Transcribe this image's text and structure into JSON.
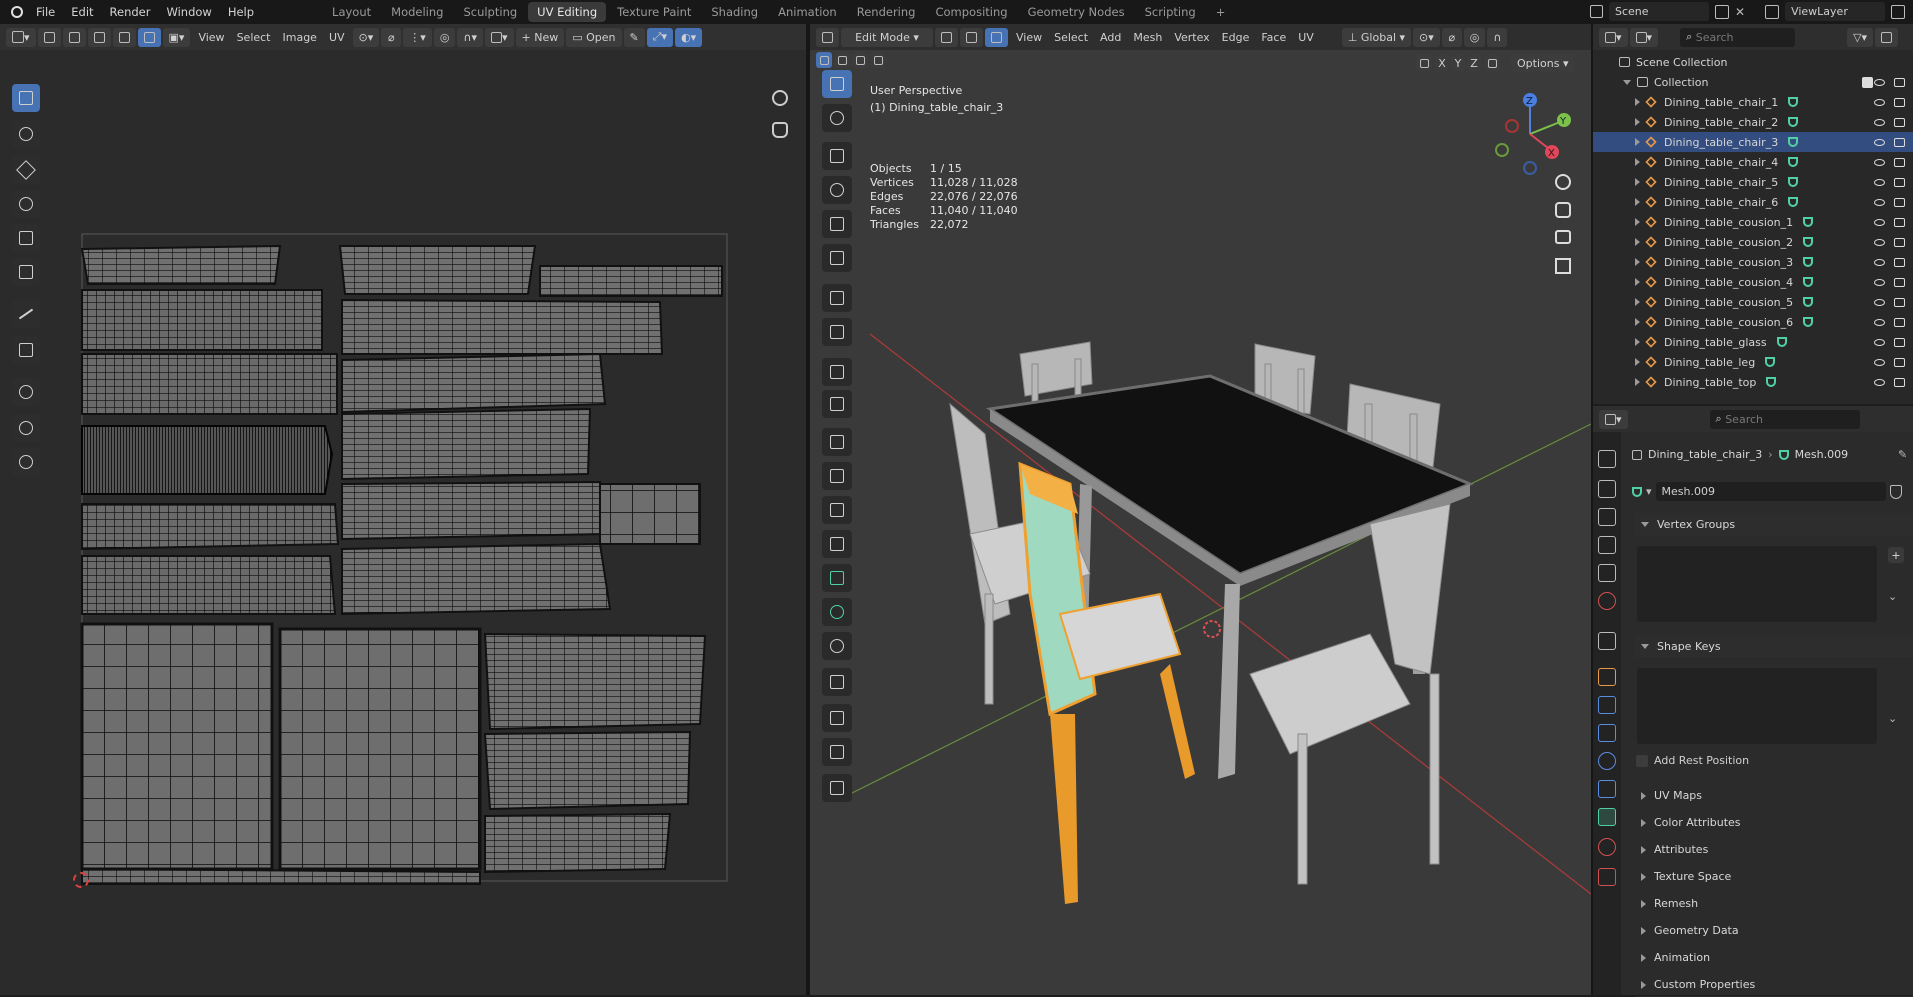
{
  "topbar": {
    "menus": [
      "File",
      "Edit",
      "Render",
      "Window",
      "Help"
    ],
    "workspaces": [
      "Layout",
      "Modeling",
      "Sculpting",
      "UV Editing",
      "Texture Paint",
      "Shading",
      "Animation",
      "Rendering",
      "Compositing",
      "Geometry Nodes",
      "Scripting"
    ],
    "active_workspace": "UV Editing",
    "add_tab": "+",
    "scene": "Scene",
    "view_layer": "ViewLayer"
  },
  "uv_editor": {
    "menus": [
      "View",
      "Select",
      "Image",
      "UV"
    ],
    "new_label": "New",
    "open_label": "Open"
  },
  "viewport": {
    "mode": "Edit Mode",
    "menus": [
      "View",
      "Select",
      "Add",
      "Mesh",
      "Vertex",
      "Edge",
      "Face",
      "UV"
    ],
    "transform_orientation": "Global",
    "options_label": "Options",
    "axes": [
      "X",
      "Y",
      "Z"
    ],
    "perspective": "User Perspective",
    "active_object": "(1) Dining_table_chair_3",
    "stats": [
      {
        "label": "Objects",
        "value": "1 / 15"
      },
      {
        "label": "Vertices",
        "value": "11,028 / 11,028"
      },
      {
        "label": "Edges",
        "value": "22,076 / 22,076"
      },
      {
        "label": "Faces",
        "value": "11,040 / 11,040"
      },
      {
        "label": "Triangles",
        "value": "22,072"
      }
    ],
    "gizmo": {
      "x": "X",
      "y": "Y",
      "z": "Z"
    }
  },
  "outliner": {
    "search_placeholder": "Search",
    "scene_collection": "Scene Collection",
    "collection": "Collection",
    "items": [
      "Dining_table_chair_1",
      "Dining_table_chair_2",
      "Dining_table_chair_3",
      "Dining_table_chair_4",
      "Dining_table_chair_5",
      "Dining_table_chair_6",
      "Dining_table_cousion_1",
      "Dining_table_cousion_2",
      "Dining_table_cousion_3",
      "Dining_table_cousion_4",
      "Dining_table_cousion_5",
      "Dining_table_cousion_6",
      "Dining_table_glass",
      "Dining_table_leg",
      "Dining_table_top"
    ],
    "selected_index": 2
  },
  "properties": {
    "search_placeholder": "Search",
    "breadcrumb_object": "Dining_table_chair_3",
    "breadcrumb_mesh": "Mesh.009",
    "mesh_name": "Mesh.009",
    "sections": [
      "Vertex Groups",
      "Shape Keys",
      "UV Maps",
      "Color Attributes",
      "Attributes",
      "Texture Space",
      "Remesh",
      "Geometry Data",
      "Animation",
      "Custom Properties"
    ],
    "add_rest_position": "Add Rest Position"
  },
  "colors": {
    "accent_blue": "#4772b3",
    "selection_orange": "#f0a030",
    "mesh_green": "#4fd1a5",
    "object_orange": "#e89a4a"
  }
}
